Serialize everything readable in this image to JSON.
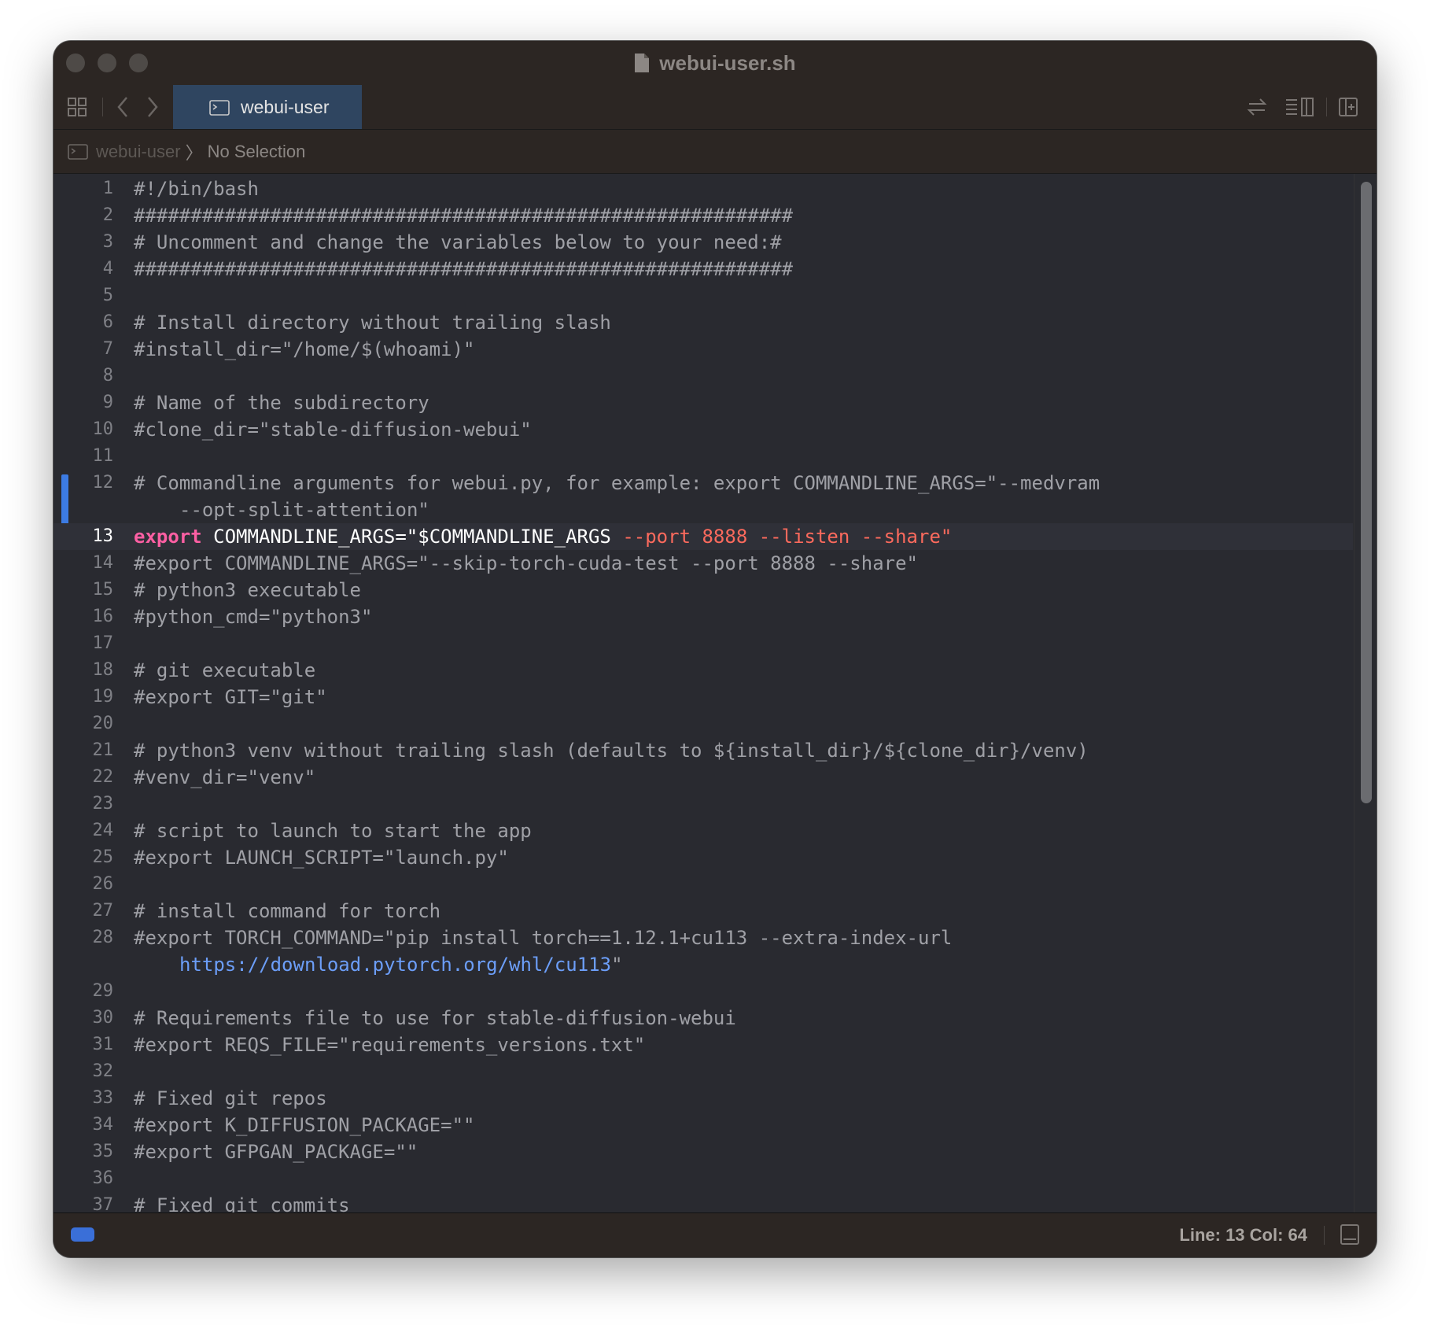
{
  "window": {
    "title": "webui-user.sh",
    "title_icon": "document-icon"
  },
  "toolbar": {
    "icons": [
      "grid-icon",
      "back-chevron-icon",
      "forward-chevron-icon",
      "swap-arrows-icon",
      "list-inspector-icon",
      "add-editor-icon"
    ],
    "tab_label": "webui-user",
    "tab_icon": "terminal-file-icon"
  },
  "breadcrumb": {
    "root": "webui-user",
    "separator": "〉",
    "current": "No Selection"
  },
  "editor": {
    "current_line": 13,
    "lines": [
      {
        "n": "1",
        "text": "#!/bin/bash"
      },
      {
        "n": "2",
        "text": "##########################################################"
      },
      {
        "n": "3",
        "text": "# Uncomment and change the variables below to your need:#"
      },
      {
        "n": "4",
        "text": "##########################################################"
      },
      {
        "n": "5",
        "text": ""
      },
      {
        "n": "6",
        "text": "# Install directory without trailing slash"
      },
      {
        "n": "7",
        "text": "#install_dir=\"/home/$(whoami)\""
      },
      {
        "n": "8",
        "text": ""
      },
      {
        "n": "9",
        "text": "# Name of the subdirectory"
      },
      {
        "n": "10",
        "text": "#clone_dir=\"stable-diffusion-webui\""
      },
      {
        "n": "11",
        "text": ""
      },
      {
        "n": "12",
        "text": "# Commandline arguments for webui.py, for example: export COMMANDLINE_ARGS=\"--medvram",
        "cont": "--opt-split-attention\""
      },
      {
        "n": "13",
        "kw": "export",
        "plain": " COMMANDLINE_ARGS=\"$COMMANDLINE_ARGS ",
        "str": "--port 8888 --listen --share\""
      },
      {
        "n": "14",
        "text": "#export COMMANDLINE_ARGS=\"--skip-torch-cuda-test --port 8888 --share\""
      },
      {
        "n": "15",
        "text": "# python3 executable"
      },
      {
        "n": "16",
        "text": "#python_cmd=\"python3\""
      },
      {
        "n": "17",
        "text": ""
      },
      {
        "n": "18",
        "text": "# git executable"
      },
      {
        "n": "19",
        "text": "#export GIT=\"git\""
      },
      {
        "n": "20",
        "text": ""
      },
      {
        "n": "21",
        "text": "# python3 venv without trailing slash (defaults to ${install_dir}/${clone_dir}/venv)"
      },
      {
        "n": "22",
        "text": "#venv_dir=\"venv\""
      },
      {
        "n": "23",
        "text": ""
      },
      {
        "n": "24",
        "text": "# script to launch to start the app"
      },
      {
        "n": "25",
        "text": "#export LAUNCH_SCRIPT=\"launch.py\""
      },
      {
        "n": "26",
        "text": ""
      },
      {
        "n": "27",
        "text": "# install command for torch"
      },
      {
        "n": "28",
        "text": "#export TORCH_COMMAND=\"pip install torch==1.12.1+cu113 --extra-index-url",
        "cont_url": "https://download.pytorch.org/whl/cu113",
        "cont_tail": "\""
      },
      {
        "n": "29",
        "text": ""
      },
      {
        "n": "30",
        "text": "# Requirements file to use for stable-diffusion-webui"
      },
      {
        "n": "31",
        "text": "#export REQS_FILE=\"requirements_versions.txt\""
      },
      {
        "n": "32",
        "text": ""
      },
      {
        "n": "33",
        "text": "# Fixed git repos"
      },
      {
        "n": "34",
        "text": "#export K_DIFFUSION_PACKAGE=\"\""
      },
      {
        "n": "35",
        "text": "#export GFPGAN_PACKAGE=\"\""
      },
      {
        "n": "36",
        "text": ""
      },
      {
        "n": "37",
        "text": "# Fixed git commits"
      }
    ]
  },
  "statusbar": {
    "position": "Line: 13  Col: 64",
    "panel_icon": "bottom-panel-icon"
  },
  "colors": {
    "keyword": "#fc5fa3",
    "string": "#fc6a5d",
    "comment": "#9fa0a6",
    "url": "#6c9ef8",
    "accent": "#3c7be3"
  }
}
